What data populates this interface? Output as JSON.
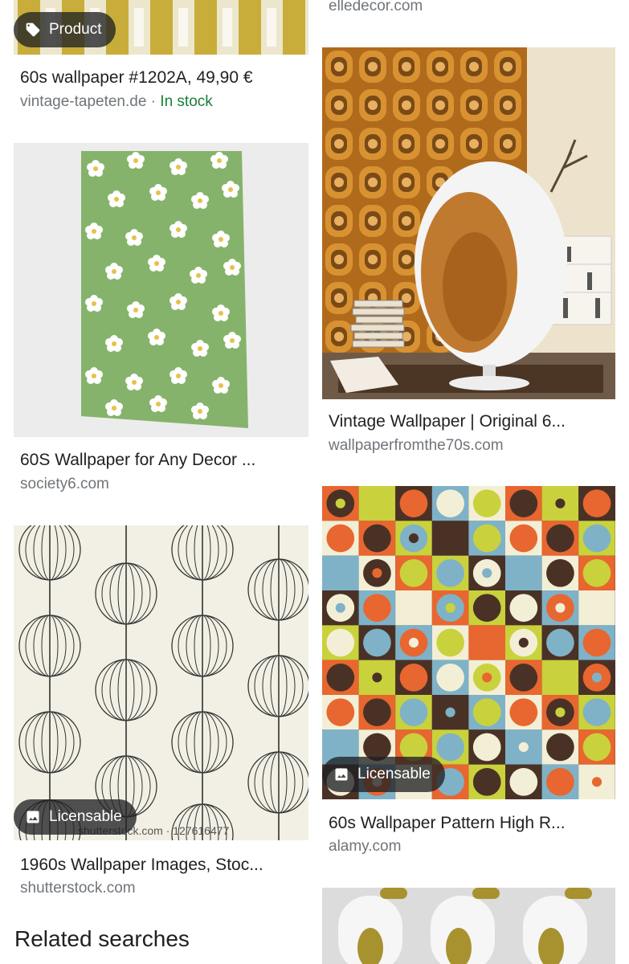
{
  "results": [
    {
      "title": "60s wallpaper #1202A, 49,90 €",
      "source": "vintage-tapeten.de",
      "separator": " · ",
      "stock": "In stock",
      "badge": "Product",
      "badge_icon": "tag-icon"
    },
    {
      "title": "",
      "source": "elledecor.com"
    },
    {
      "title": "60S Wallpaper for Any Decor ...",
      "source": "society6.com"
    },
    {
      "title": "Vintage Wallpaper | Original 6...",
      "source": "wallpaperfromthe70s.com"
    },
    {
      "title": "1960s Wallpaper Images, Stoc...",
      "source": "shutterstock.com",
      "badge": "Licensable",
      "badge_icon": "image-icon",
      "watermark": "shutterstock.com · 127616477"
    },
    {
      "title": "60s Wallpaper Pattern High R...",
      "source": "alamy.com",
      "badge": "Licensable",
      "badge_icon": "image-icon"
    }
  ],
  "related_searches": "Related searches"
}
